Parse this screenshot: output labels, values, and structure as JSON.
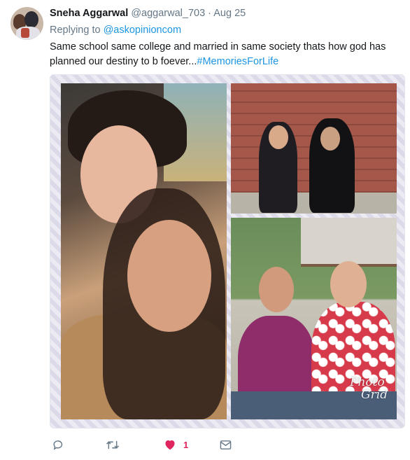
{
  "tweet": {
    "name": "Sneha Aggarwal",
    "handle": "@aggarwal_703",
    "separator": "·",
    "date": "Aug 25",
    "replying_prefix": "Replying to",
    "replying_to": "@askopinioncom",
    "text_body": "Same school same college and married in same society thats how god has planned our destiny to b foever...",
    "hashtag": "#MemoriesForLife"
  },
  "media": {
    "watermark_line1": "Photo",
    "watermark_line2": "Grid"
  },
  "actions": {
    "like_count": "1"
  },
  "colors": {
    "link": "#1b95e0",
    "like": "#e0245e",
    "secondary_text": "#657786"
  },
  "icons": [
    "reply-icon",
    "retweet-icon",
    "heart-icon",
    "direct-message-icon"
  ]
}
